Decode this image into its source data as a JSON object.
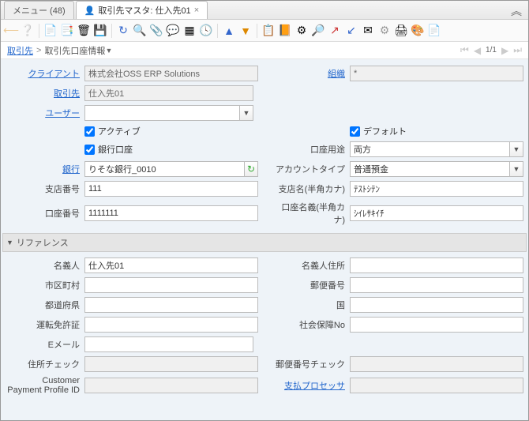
{
  "tabs": {
    "t1": "メニュー (48)",
    "t2": "取引先マスタ: 仕入先01"
  },
  "breadcrumb": {
    "a": "取引先",
    "b": "取引先口座情報",
    "pager": "1/1"
  },
  "labels": {
    "client": "クライアント",
    "org": "組織",
    "bp": "取引先",
    "user": "ユーザー",
    "active": "アクティブ",
    "default": "デフォルト",
    "bankacct": "銀行口座",
    "usage": "口座用途",
    "bank": "銀行",
    "accttype": "アカウントタイプ",
    "branchno": "支店番号",
    "branchkana": "支店名(半角カナ)",
    "acctno": "口座番号",
    "acctkana": "口座名義(半角カナ)",
    "section": "リファレンス",
    "holder": "名義人",
    "holderaddr": "名義人住所",
    "city": "市区町村",
    "zip": "郵便番号",
    "pref": "都道府県",
    "country": "国",
    "license": "運転免許証",
    "ssn": "社会保障No",
    "email": "Eメール",
    "addrchk": "住所チェック",
    "zipchk": "郵便番号チェック",
    "custprof": "Customer Payment Profile ID",
    "payproc": "支払プロセッサ"
  },
  "values": {
    "client": "株式会社OSS ERP Solutions",
    "org": "*",
    "bp": "仕入先01",
    "usage": "両方",
    "bank": "りそな銀行_0010",
    "accttype": "普通預金",
    "branchno": "111",
    "branchkana": "ﾃｽﾄｼﾃﾝ",
    "acctno": "1111111",
    "acctkana": "ｼｲﾚｻｷｲﾁ",
    "holder": "仕入先01"
  }
}
